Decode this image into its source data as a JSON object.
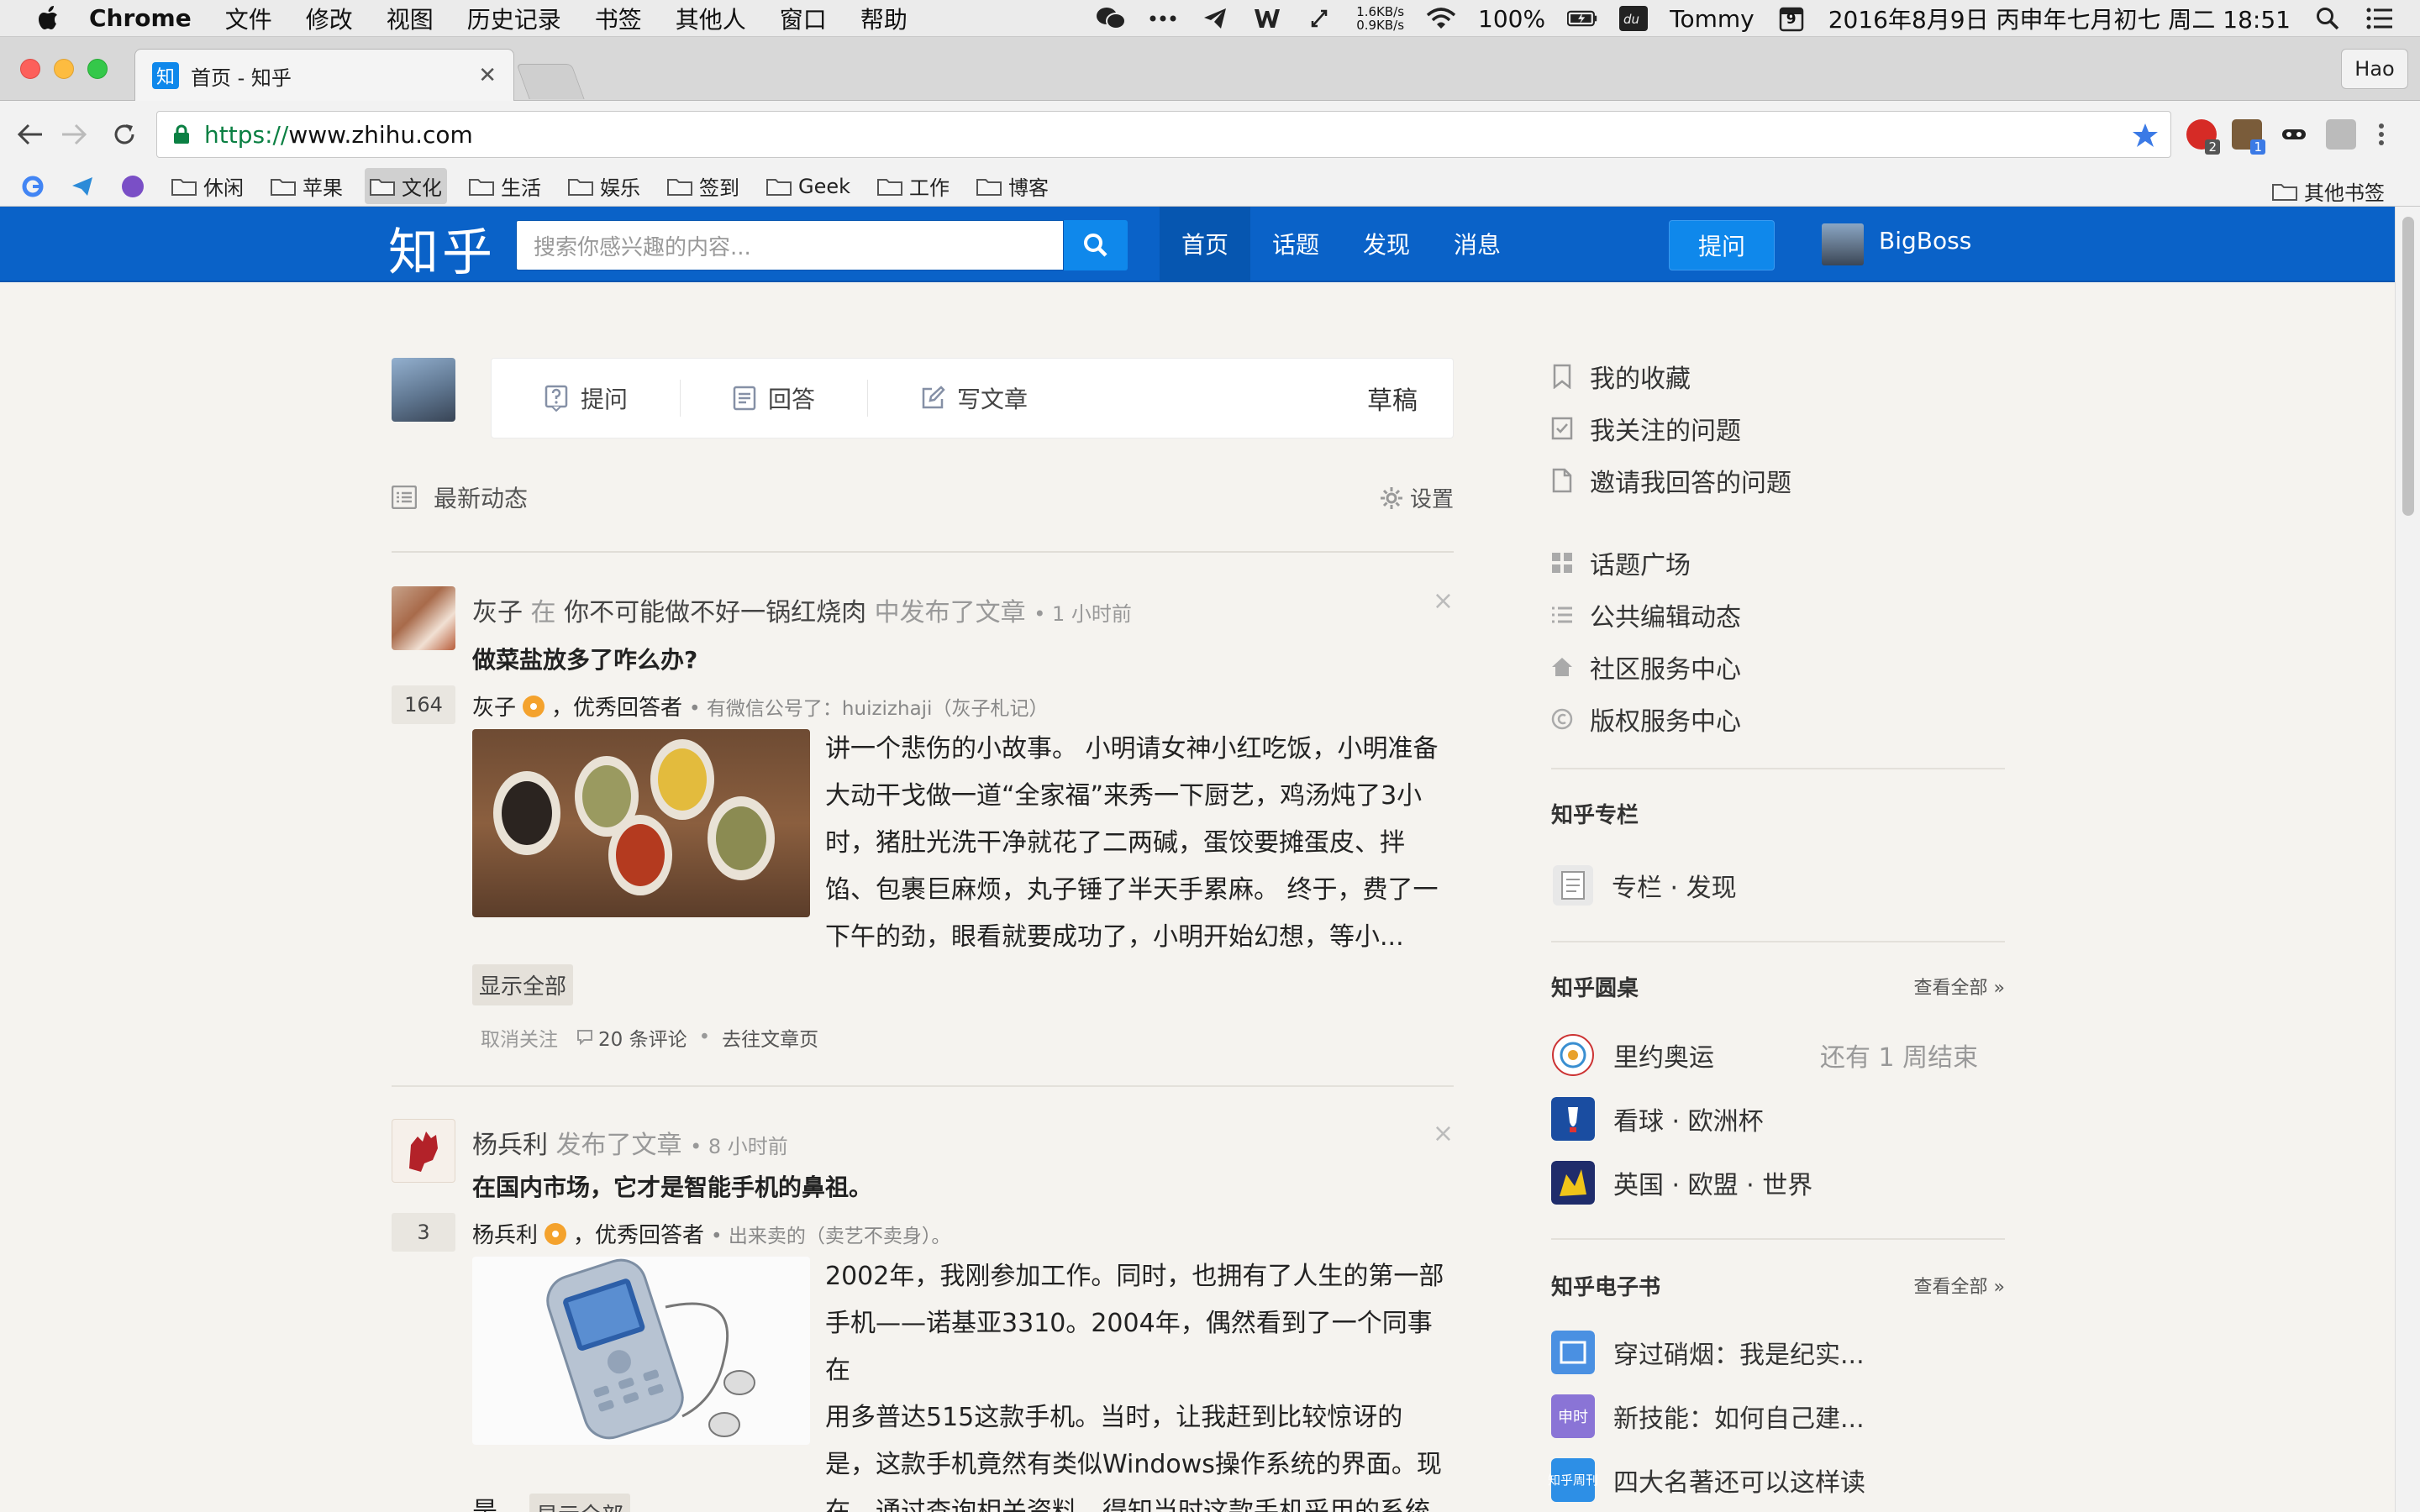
{
  "menubar": {
    "app_name": "Chrome",
    "items": [
      "文件",
      "修改",
      "视图",
      "历史记录",
      "书签",
      "其他人",
      "窗口",
      "帮助"
    ],
    "net_up": "1.6KB/s",
    "net_down": "0.9KB/s",
    "battery": "100%",
    "user": "Tommy",
    "calendar_day": "9",
    "datetime": "2016年8月9日 丙申年七月初七 周二 18:51"
  },
  "browser": {
    "tab_title": "首页 - 知乎",
    "tab_favicon": "知",
    "profile_button": "Hao",
    "url_protocol": "https://",
    "url_host": "www.zhihu.com",
    "extension_badges": [
      "2",
      "1"
    ],
    "bookmarks": [
      "休闲",
      "苹果",
      "文化",
      "生活",
      "娱乐",
      "签到",
      "Geek",
      "工作",
      "博客"
    ],
    "other_bookmarks": "其他书签"
  },
  "topbar": {
    "logo": "知乎",
    "search_placeholder": "搜索你感兴趣的内容...",
    "nav": [
      "首页",
      "话题",
      "发现",
      "消息"
    ],
    "ask_button": "提问",
    "username": "BigBoss"
  },
  "composer": {
    "ask": "提问",
    "answer": "回答",
    "write": "写文章",
    "draft": "草稿"
  },
  "feed_header": {
    "title": "最新动态",
    "settings": "设置"
  },
  "feed": [
    {
      "actor": "灰子",
      "in_word": "在",
      "column": "你不可能做不好一锅红烧肉",
      "action": "中发布了文章",
      "time": "1 小时前",
      "title": "做菜盐放多了咋么办?",
      "votes": "164",
      "author": "灰子",
      "author_role": "，优秀回答者",
      "author_bio": "• 有微信公号了：huizizhaji（灰子札记）",
      "excerpt_lines": [
        "讲一个悲伤的小故事。 小明请女神小红吃饭，小明准备",
        "大动干戈做一道“全家福”来秀一下厨艺，鸡汤炖了3小",
        "时，猪肚光洗干净就花了二两碱，蛋饺要摊蛋皮、拌",
        "馅、包裹巨麻烦，丸子锤了半天手累麻。 终于，费了一",
        "下午的劲，眼看就要成功了，小明开始幻想，等小..."
      ],
      "show_all": "显示全部",
      "unfollow": "取消关注",
      "comments": "20 条评论",
      "goto": "去往文章页"
    },
    {
      "actor": "杨兵利",
      "action": "发布了文章",
      "time": "8 小时前",
      "title": "在国内市场，它才是智能手机的鼻祖。",
      "votes": "3",
      "author": "杨兵利",
      "author_role": "，优秀回答者",
      "author_bio": "• 出来卖的（卖艺不卖身）。",
      "excerpt_lines": [
        "2002年，我刚参加工作。同时，也拥有了人生的第一部",
        "手机——诺基亚3310。2004年，偶然看到了一个同事在",
        "用多普达515这款手机。当时，让我赶到比较惊讶的",
        "是，这款手机竟然有类似Windows操作系统的界面。现",
        "在，通过查询相关资料，得知当时这款手机采用的系统"
      ],
      "tail": "是...",
      "show_all": "显示全部"
    }
  ],
  "sidebar": {
    "links1": [
      "我的收藏",
      "我关注的问题",
      "邀请我回答的问题"
    ],
    "links2": [
      "话题广场",
      "公共编辑动态",
      "社区服务中心",
      "版权服务中心"
    ],
    "columns_header": "知乎专栏",
    "columns_link": "专栏 · 发现",
    "roundtable_header": "知乎圆桌",
    "roundtable_see_all": "查看全部 »",
    "roundtables": [
      {
        "name": "里约奥运",
        "extra": "还有 1 周结束"
      },
      {
        "name": "看球 · 欧洲杯"
      },
      {
        "name": "英国 · 欧盟 · 世界"
      }
    ],
    "ebook_header": "知乎电子书",
    "ebook_see_all": "查看全部 »",
    "ebooks": [
      "穿过硝烟：我是纪实...",
      "新技能：如何自己建...",
      "四大名著还可以这样读"
    ],
    "ebook_icon_labels": [
      "",
      "申时",
      "知乎周刊"
    ]
  },
  "colors": {
    "zhihu_blue": "#0a62c8",
    "zhihu_button": "#0f88eb",
    "page_bg": "#f5f3ef"
  }
}
